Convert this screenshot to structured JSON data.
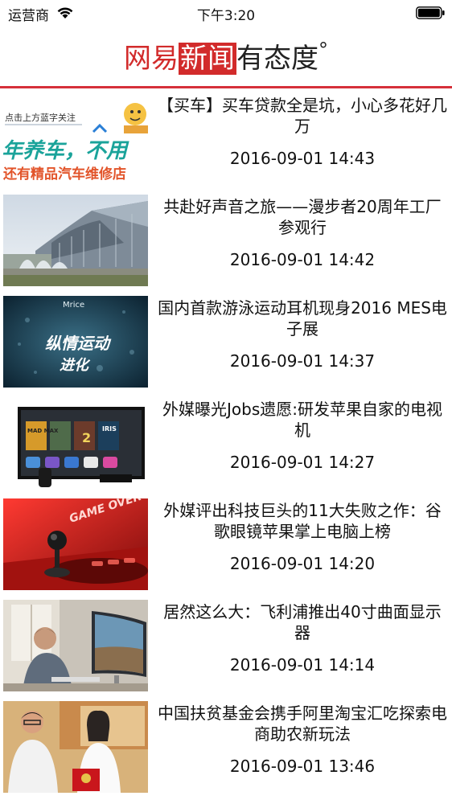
{
  "status_bar": {
    "carrier": "运营商",
    "time": "下午3:20"
  },
  "header": {
    "logo_part1": "网易",
    "logo_part2": "新闻",
    "logo_part3": "有态度",
    "logo_mark": "°",
    "accent_color": "#d6303a"
  },
  "news": [
    {
      "title": "【买车】买车贷款全是坑，小心多花好几万",
      "time": "2016-09-01 14:43",
      "thumb_icon": "car-promo-banner-image",
      "thumb_text": {
        "line1": "点击上方蓝字关注",
        "line2": "年养车，不用",
        "line3": "还有精品汽车维修店"
      }
    },
    {
      "title": "共赴好声音之旅——漫步者20周年工厂参观行",
      "time": "2016-09-01 14:42",
      "thumb_icon": "modern-building-image"
    },
    {
      "title": "国内首款游泳运动耳机现身2016 MES电子展",
      "time": "2016-09-01 14:37",
      "thumb_icon": "swimming-earphone-ad-image",
      "thumb_text": {
        "brand": "Mrice",
        "slogan1": "纵情运动",
        "slogan2": "进化"
      }
    },
    {
      "title": "外媒曝光Jobs遗愿:研发苹果自家的电视机",
      "time": "2016-09-01 14:27",
      "thumb_icon": "apple-tv-screen-image",
      "thumb_text": {
        "tile1": "MAD MAX",
        "tile2": "2",
        "tile3": "IRIS"
      }
    },
    {
      "title": "外媒评出科技巨头的11大失败之作：谷歌眼镜苹果掌上电脑上榜",
      "time": "2016-09-01 14:20",
      "thumb_icon": "game-over-joystick-image",
      "thumb_text": {
        "caption": "GAME OVER"
      }
    },
    {
      "title": "居然这么大：飞利浦推出40寸曲面显示器",
      "time": "2016-09-01 14:14",
      "thumb_icon": "curved-monitor-image"
    },
    {
      "title": "中国扶贫基金会携手阿里淘宝汇吃探索电商助农新玩法",
      "time": "2016-09-01 13:46",
      "thumb_icon": "charity-event-photo-image"
    }
  ]
}
